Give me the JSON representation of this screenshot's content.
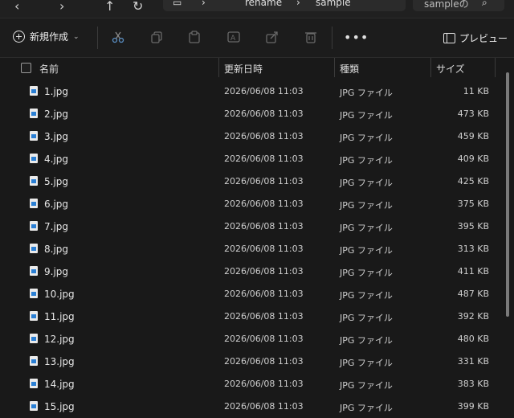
{
  "address": {
    "crumbs": [
      "rename",
      "sample"
    ],
    "search_placeholder": "sampleの"
  },
  "toolbar": {
    "new_label": "新規作成",
    "preview_label": "プレビュー"
  },
  "columns": {
    "name": "名前",
    "date": "更新日時",
    "type": "種類",
    "size": "サイズ"
  },
  "files": [
    {
      "name": "1.jpg",
      "date": "2026/06/08 11:03",
      "type": "JPG ファイル",
      "size": "11 KB"
    },
    {
      "name": "2.jpg",
      "date": "2026/06/08 11:03",
      "type": "JPG ファイル",
      "size": "473 KB"
    },
    {
      "name": "3.jpg",
      "date": "2026/06/08 11:03",
      "type": "JPG ファイル",
      "size": "459 KB"
    },
    {
      "name": "4.jpg",
      "date": "2026/06/08 11:03",
      "type": "JPG ファイル",
      "size": "409 KB"
    },
    {
      "name": "5.jpg",
      "date": "2026/06/08 11:03",
      "type": "JPG ファイル",
      "size": "425 KB"
    },
    {
      "name": "6.jpg",
      "date": "2026/06/08 11:03",
      "type": "JPG ファイル",
      "size": "375 KB"
    },
    {
      "name": "7.jpg",
      "date": "2026/06/08 11:03",
      "type": "JPG ファイル",
      "size": "395 KB"
    },
    {
      "name": "8.jpg",
      "date": "2026/06/08 11:03",
      "type": "JPG ファイル",
      "size": "313 KB"
    },
    {
      "name": "9.jpg",
      "date": "2026/06/08 11:03",
      "type": "JPG ファイル",
      "size": "411 KB"
    },
    {
      "name": "10.jpg",
      "date": "2026/06/08 11:03",
      "type": "JPG ファイル",
      "size": "487 KB"
    },
    {
      "name": "11.jpg",
      "date": "2026/06/08 11:03",
      "type": "JPG ファイル",
      "size": "392 KB"
    },
    {
      "name": "12.jpg",
      "date": "2026/06/08 11:03",
      "type": "JPG ファイル",
      "size": "480 KB"
    },
    {
      "name": "13.jpg",
      "date": "2026/06/08 11:03",
      "type": "JPG ファイル",
      "size": "331 KB"
    },
    {
      "name": "14.jpg",
      "date": "2026/06/08 11:03",
      "type": "JPG ファイル",
      "size": "383 KB"
    },
    {
      "name": "15.jpg",
      "date": "2026/06/08 11:03",
      "type": "JPG ファイル",
      "size": "399 KB"
    }
  ]
}
